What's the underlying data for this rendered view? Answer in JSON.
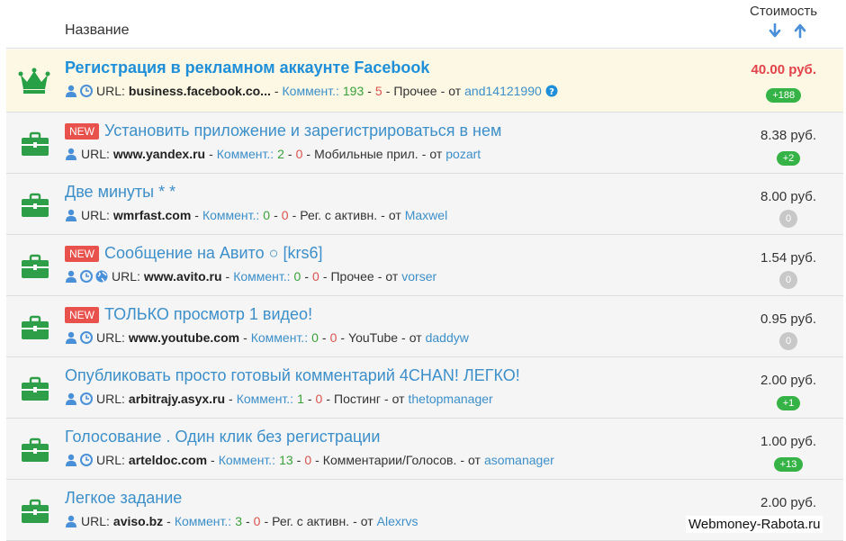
{
  "header": {
    "name": "Название",
    "cost": "Стоимость"
  },
  "rows": [
    {
      "vip": true,
      "new": "",
      "title": "Регистрация в рекламном аккаунте Facebook",
      "icons": [
        "user-icon",
        "clock-icon"
      ],
      "url_label": "URL:",
      "url": "business.facebook.co...",
      "comm_label": "Коммент.:",
      "pos": "193",
      "neg": "5",
      "cat": "Прочее",
      "from": "от",
      "author": "and14121990",
      "help": true,
      "price": "40.00 руб.",
      "pill": "+188",
      "pill_type": "green"
    },
    {
      "vip": false,
      "new": "NEW",
      "title": "Установить приложение и зарегистрироваться в нем",
      "icons": [
        "user-icon"
      ],
      "url_label": "URL:",
      "url": "www.yandex.ru",
      "comm_label": "Коммент.:",
      "pos": "2",
      "neg": "0",
      "cat": "Мобильные прил.",
      "from": "от",
      "author": "pozart",
      "help": false,
      "price": "8.38 руб.",
      "pill": "+2",
      "pill_type": "green"
    },
    {
      "vip": false,
      "new": "",
      "title": "Две минуты * *",
      "icons": [
        "user-icon"
      ],
      "url_label": "URL:",
      "url": "wmrfast.com",
      "comm_label": "Коммент.:",
      "pos": "0",
      "neg": "0",
      "cat": "Рег. с активн.",
      "from": "от",
      "author": "Maxwel",
      "help": false,
      "price": "8.00 руб.",
      "pill": "0",
      "pill_type": "grey"
    },
    {
      "vip": false,
      "new": "NEW",
      "title": "Сообщение на Авито ○ [krs6]",
      "icons": [
        "user-icon",
        "clock-icon",
        "globe-icon"
      ],
      "url_label": "URL:",
      "url": "www.avito.ru",
      "comm_label": "Коммент.:",
      "pos": "0",
      "neg": "0",
      "cat": "Прочее",
      "from": "от",
      "author": "vorser",
      "help": false,
      "price": "1.54 руб.",
      "pill": "0",
      "pill_type": "grey"
    },
    {
      "vip": false,
      "new": "NEW",
      "title": "ТОЛЬКО просмотр 1 видео!",
      "icons": [
        "user-icon",
        "clock-icon"
      ],
      "url_label": "URL:",
      "url": "www.youtube.com",
      "comm_label": "Коммент.:",
      "pos": "0",
      "neg": "0",
      "cat": "YouTube",
      "from": "от",
      "author": "daddyw",
      "help": false,
      "price": "0.95 руб.",
      "pill": "0",
      "pill_type": "grey"
    },
    {
      "vip": false,
      "new": "",
      "title": "Опубликовать просто готовый комментарий 4CHAN! ЛЕГКО!",
      "icons": [
        "user-icon",
        "clock-icon"
      ],
      "url_label": "URL:",
      "url": "arbitrajy.asyx.ru",
      "comm_label": "Коммент.:",
      "pos": "1",
      "neg": "0",
      "cat": "Постинг",
      "from": "от",
      "author": "thetopmanager",
      "help": false,
      "price": "2.00 руб.",
      "pill": "+1",
      "pill_type": "green"
    },
    {
      "vip": false,
      "new": "",
      "title": "Голосование . Один клик без регистрации",
      "icons": [
        "user-icon",
        "clock-icon"
      ],
      "url_label": "URL:",
      "url": "arteldoc.com",
      "comm_label": "Коммент.:",
      "pos": "13",
      "neg": "0",
      "cat": "Комментарии/Голосов.",
      "from": "от",
      "author": "asomanager",
      "help": false,
      "price": "1.00 руб.",
      "pill": "+13",
      "pill_type": "green"
    },
    {
      "vip": false,
      "new": "",
      "title": "Легкое задание",
      "icons": [
        "user-icon"
      ],
      "url_label": "URL:",
      "url": "aviso.bz",
      "comm_label": "Коммент.:",
      "pos": "3",
      "neg": "0",
      "cat": "Рег. с активн.",
      "from": "от",
      "author": "Alexrvs",
      "help": false,
      "price": "2.00 руб.",
      "pill": "",
      "pill_type": "green"
    }
  ],
  "watermark": "Webmoney-Rabota.ru",
  "colors": {
    "link": "#3d8fc9",
    "green": "#36b346",
    "red": "#e3424b",
    "vip_bg": "#fcf8e3"
  }
}
